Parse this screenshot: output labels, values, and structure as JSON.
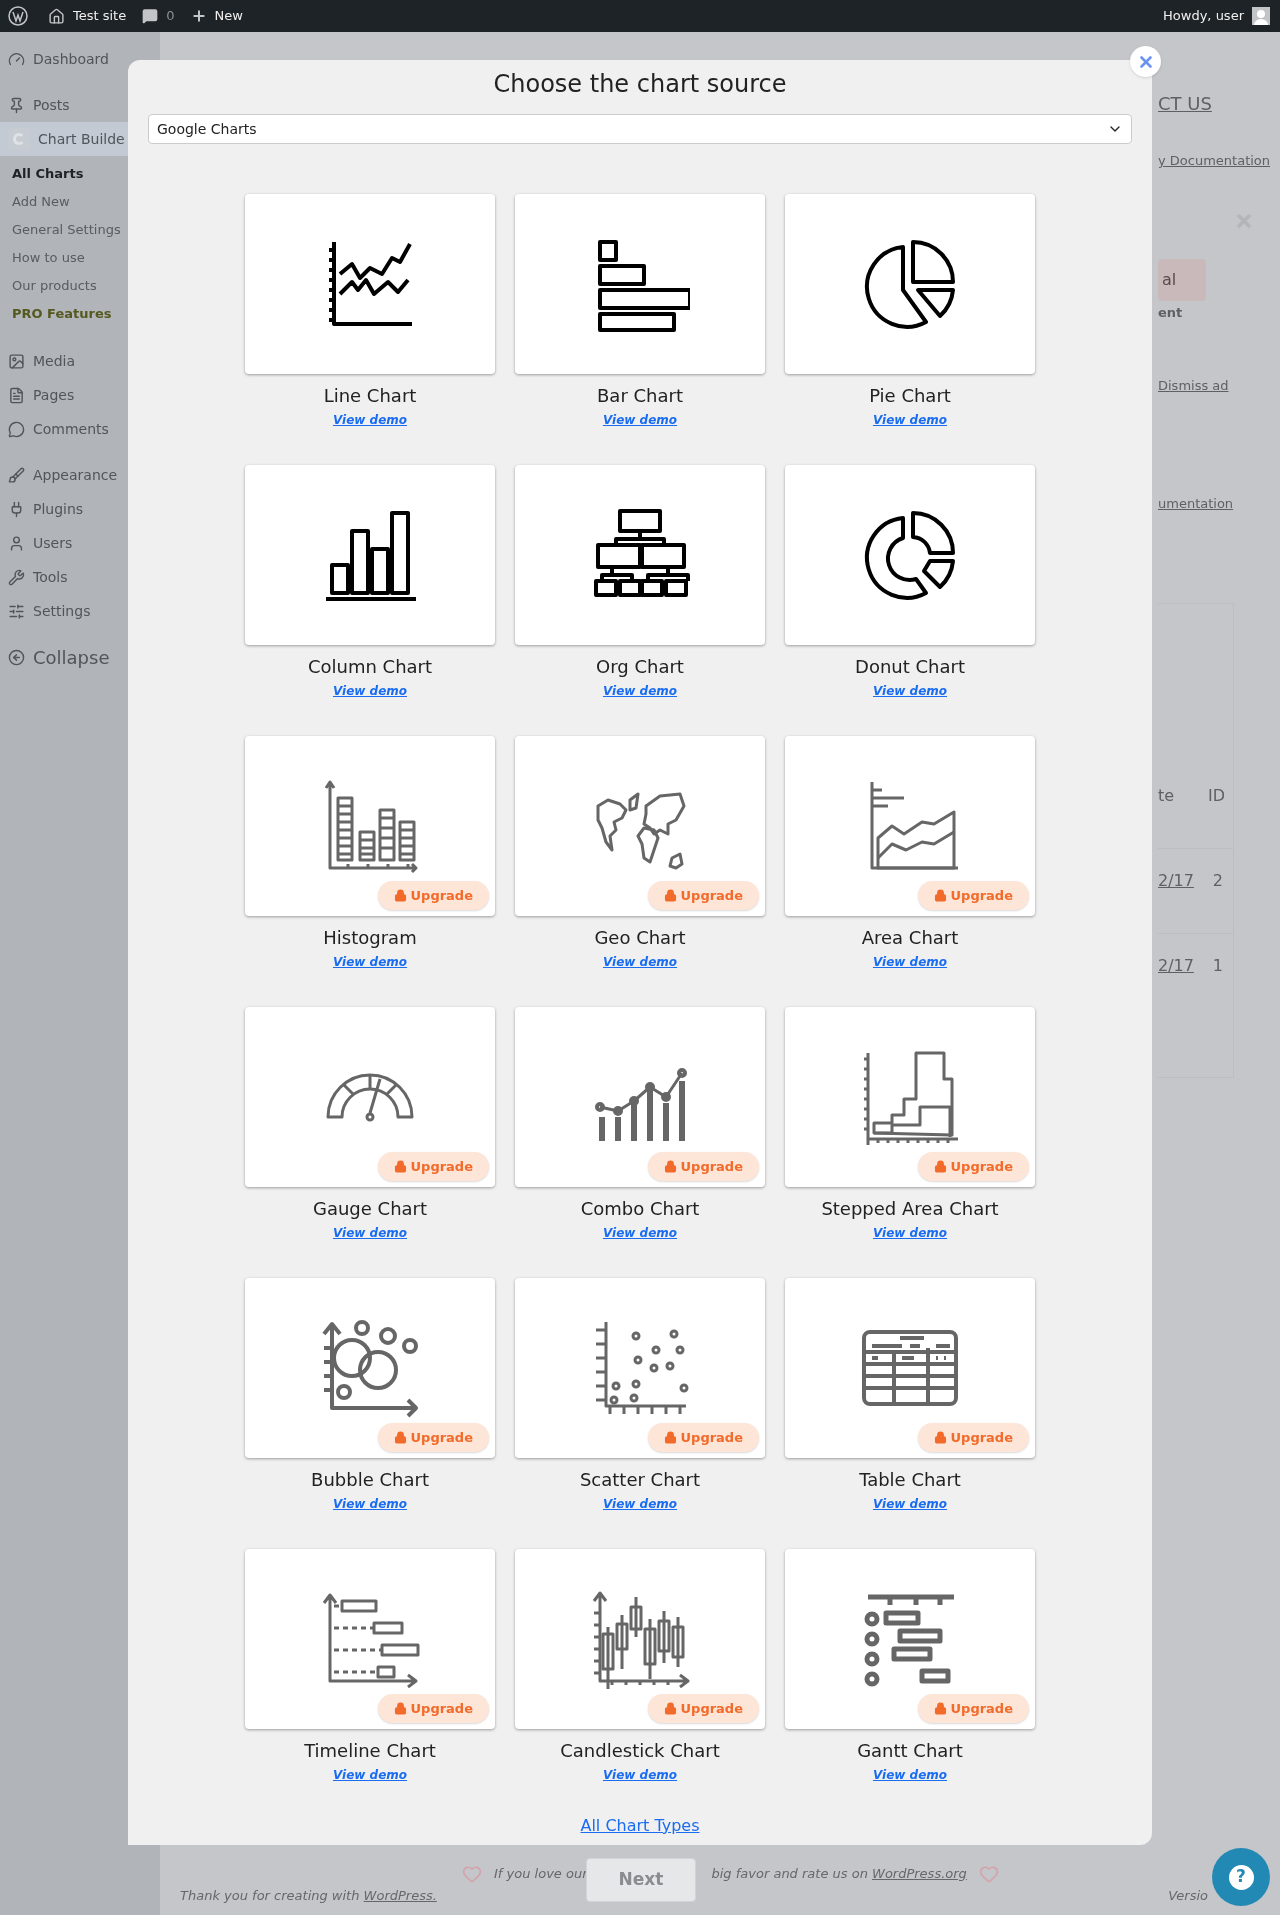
{
  "admin_bar": {
    "site": "Test site",
    "comments": "0",
    "new": "New",
    "greeting": "Howdy, user"
  },
  "sidebar": {
    "items": [
      {
        "label": "Dashboard",
        "selected": false
      },
      {
        "label": "Posts",
        "selected": false
      },
      {
        "label": "Chart Builde",
        "selected": true,
        "children": [
          {
            "label": "All Charts",
            "selected": true,
            "kind": "link"
          },
          {
            "label": "Add New",
            "selected": false,
            "kind": "link"
          },
          {
            "label": "General Settings",
            "selected": false,
            "kind": "link"
          },
          {
            "label": "How to use",
            "selected": false,
            "kind": "link"
          },
          {
            "label": "Our products",
            "selected": false,
            "kind": "link"
          },
          {
            "label": "PRO Features",
            "selected": false,
            "kind": "pro"
          }
        ]
      },
      {
        "label": "Media",
        "selected": false
      },
      {
        "label": "Pages",
        "selected": false
      },
      {
        "label": "Comments",
        "selected": false
      },
      {
        "label": "Appearance",
        "selected": false
      },
      {
        "label": "Plugins",
        "selected": false
      },
      {
        "label": "Users",
        "selected": false
      },
      {
        "label": "Tools",
        "selected": false
      },
      {
        "label": "Settings",
        "selected": false
      },
      {
        "label": "Collapse",
        "selected": false
      }
    ]
  },
  "background": {
    "contact_link": "CT US",
    "docs_link": "y Documentation",
    "promo_button": "al",
    "promo_caption": "ent",
    "dismiss_link": "Dismiss ad",
    "docs_link_2": "umentation",
    "table": {
      "columns": [
        "te",
        "ID"
      ],
      "rows": [
        [
          "2/17",
          "2"
        ],
        [
          "2/17",
          "1"
        ]
      ]
    }
  },
  "modal": {
    "title": "Choose the chart source",
    "source": "Google Charts",
    "charts": [
      {
        "name": "Line Chart",
        "demo": "View demo"
      },
      {
        "name": "Bar Chart",
        "demo": "View demo"
      },
      {
        "name": "Pie Chart",
        "demo": "View demo"
      },
      {
        "name": "Column Chart",
        "demo": "View demo"
      },
      {
        "name": "Org Chart",
        "demo": "View demo"
      },
      {
        "name": "Donut Chart",
        "demo": "View demo"
      },
      {
        "name": "Histogram",
        "demo": "View demo",
        "badge": "Upgrade"
      },
      {
        "name": "Geo Chart",
        "demo": "View demo",
        "badge": "Upgrade"
      },
      {
        "name": "Area Chart",
        "demo": "View demo",
        "badge": "Upgrade"
      },
      {
        "name": "Gauge Chart",
        "demo": "View demo",
        "badge": "Upgrade"
      },
      {
        "name": "Combo Chart",
        "demo": "View demo",
        "badge": "Upgrade"
      },
      {
        "name": "Stepped Area Chart",
        "demo": "View demo",
        "badge": "Upgrade"
      },
      {
        "name": "Bubble Chart",
        "demo": "View demo",
        "badge": "Upgrade"
      },
      {
        "name": "Scatter Chart",
        "demo": "View demo",
        "badge": "Upgrade"
      },
      {
        "name": "Table Chart",
        "demo": "View demo",
        "badge": "Upgrade"
      },
      {
        "name": "Timeline Chart",
        "demo": "View demo",
        "badge": "Upgrade"
      },
      {
        "name": "Candlestick Chart",
        "demo": "View demo",
        "badge": "Upgrade"
      },
      {
        "name": "Gantt Chart",
        "demo": "View demo",
        "badge": "Upgrade"
      }
    ],
    "all_types_link": "All Chart Types"
  },
  "next_button": "Next",
  "footer": {
    "rate_before": "If you love our",
    "rate_after": "big favor and rate us on",
    "rate_link": "WordPress.org",
    "thanks": "Thank you for creating with",
    "thanks_link": "WordPress.",
    "version": "Versio"
  },
  "help_button": "?"
}
